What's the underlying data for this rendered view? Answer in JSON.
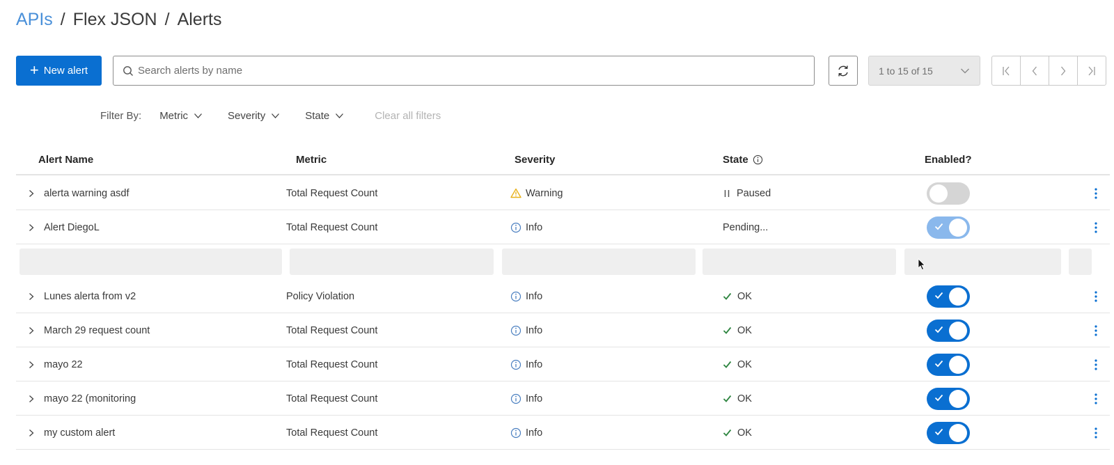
{
  "breadcrumb": {
    "root": "APIs",
    "api": "Flex JSON",
    "current": "Alerts",
    "separator": "/"
  },
  "toolbar": {
    "new_alert_label": "New alert",
    "search_placeholder": "Search alerts by name",
    "page_range": "1 to 15 of 15"
  },
  "filters": {
    "label": "Filter By:",
    "items": [
      "Metric",
      "Severity",
      "State"
    ],
    "clear_label": "Clear all filters"
  },
  "table": {
    "headers": {
      "name": "Alert Name",
      "metric": "Metric",
      "severity": "Severity",
      "state": "State",
      "enabled": "Enabled?"
    },
    "rows": [
      {
        "name": "alerta warning asdf",
        "metric": "Total Request Count",
        "severity": "Warning",
        "severity_icon": "warning-icon",
        "state": "Paused",
        "state_icon": "pause-icon",
        "enabled": "off"
      },
      {
        "name": "Alert DiegoL",
        "metric": "Total Request Count",
        "severity": "Info",
        "severity_icon": "info-icon",
        "state": "Pending...",
        "state_icon": "",
        "enabled": "pending"
      },
      {
        "name": "Lunes alerta from v2",
        "metric": "Policy Violation",
        "severity": "Info",
        "severity_icon": "info-icon",
        "state": "OK",
        "state_icon": "check-icon",
        "enabled": "on"
      },
      {
        "name": "March 29 request count",
        "metric": "Total Request Count",
        "severity": "Info",
        "severity_icon": "info-icon",
        "state": "OK",
        "state_icon": "check-icon",
        "enabled": "on"
      },
      {
        "name": "mayo 22",
        "metric": "Total Request Count",
        "severity": "Info",
        "severity_icon": "info-icon",
        "state": "OK",
        "state_icon": "check-icon",
        "enabled": "on"
      },
      {
        "name": "mayo 22 (monitoring",
        "metric": "Total Request Count",
        "severity": "Info",
        "severity_icon": "info-icon",
        "state": "OK",
        "state_icon": "check-icon",
        "enabled": "on"
      },
      {
        "name": "my custom alert",
        "metric": "Total Request Count",
        "severity": "Info",
        "severity_icon": "info-icon",
        "state": "OK",
        "state_icon": "check-icon",
        "enabled": "on"
      }
    ]
  },
  "colors": {
    "accent": "#0a6fd1",
    "link": "#4a90d9",
    "warning": "#e8b21c",
    "ok": "#2e8540"
  }
}
